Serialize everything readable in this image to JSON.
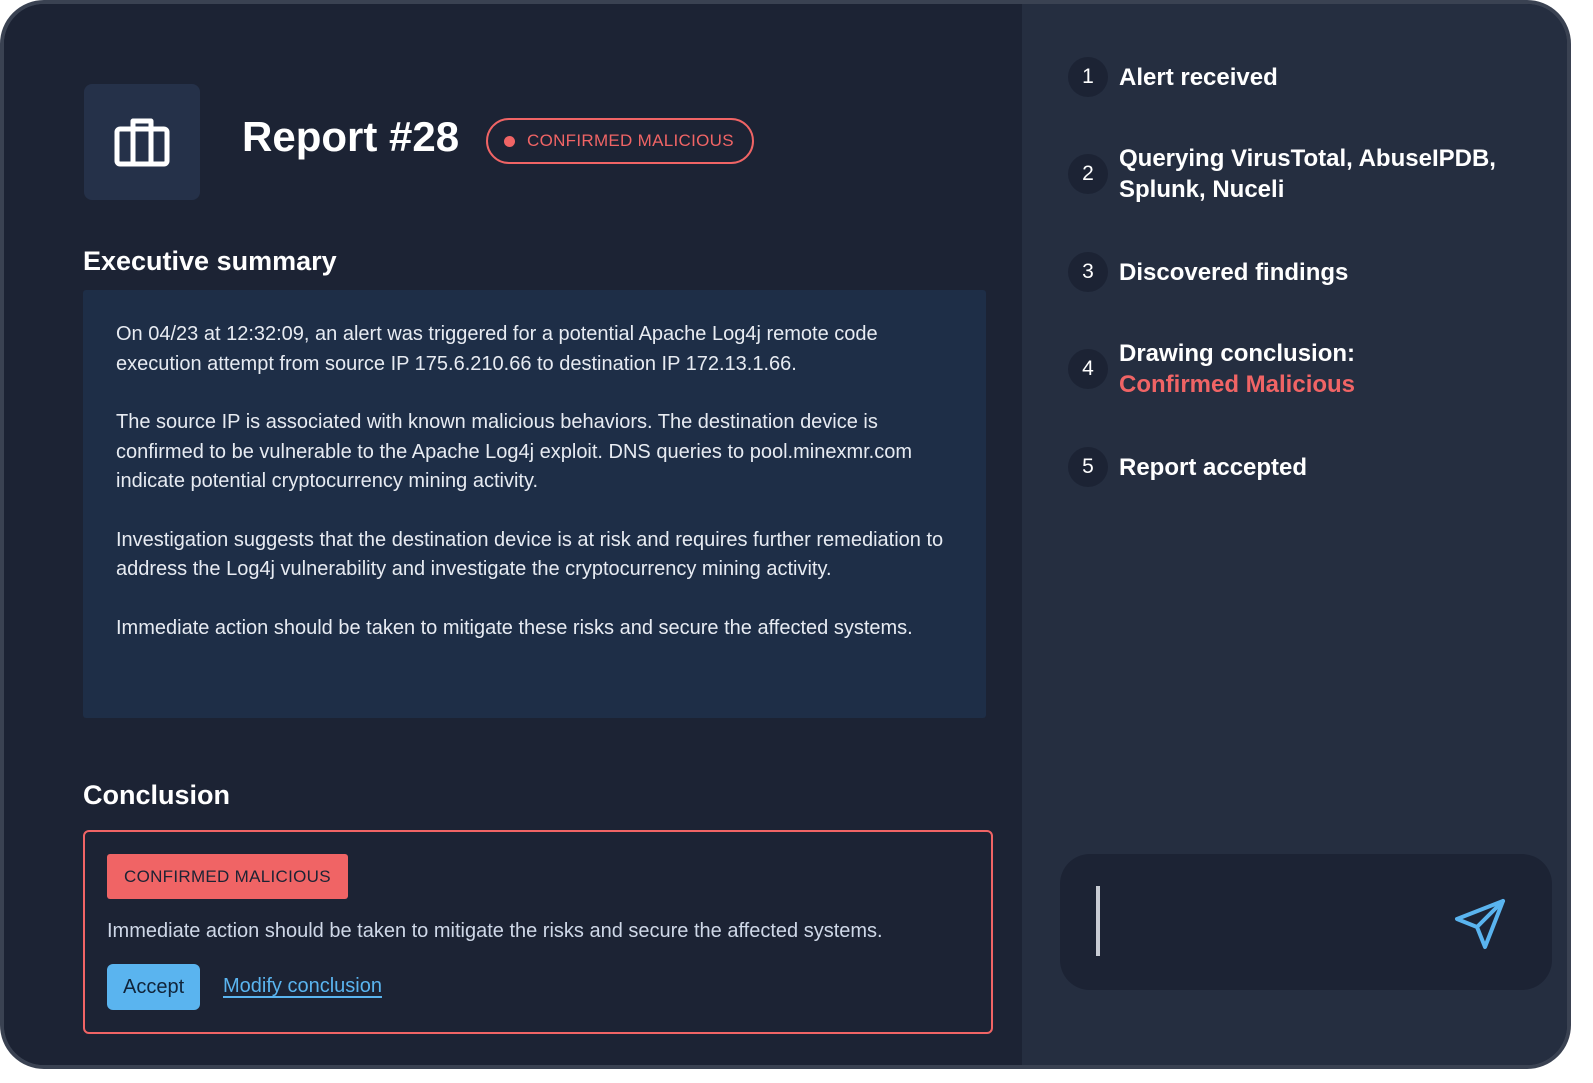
{
  "report": {
    "title": "Report #28",
    "status_badge": "CONFIRMED MALICIOUS",
    "logo_icon": "briefcase-icon"
  },
  "summary": {
    "heading": "Executive summary",
    "paragraphs": [
      "On 04/23 at 12:32:09, an alert was triggered for a potential Apache Log4j remote code execution attempt from source IP 175.6.210.66 to destination IP 172.13.1.66.",
      "The source IP is associated with known malicious behaviors. The destination device is confirmed to be vulnerable to the Apache Log4j exploit. DNS queries to pool.minexmr.com indicate potential cryptocurrency mining activity.",
      "Investigation suggests that the destination device is at risk and requires further remediation to address the Log4j vulnerability and investigate the cryptocurrency mining activity.",
      "Immediate action should be taken to mitigate these risks and secure the affected systems."
    ]
  },
  "conclusion": {
    "heading": "Conclusion",
    "badge": "CONFIRMED MALICIOUS",
    "text": "Immediate action should be taken to mitigate the risks and secure the affected systems.",
    "accept_label": "Accept",
    "modify_label": "Modify conclusion"
  },
  "steps": [
    {
      "number": "1",
      "label": "Alert received"
    },
    {
      "number": "2",
      "label": "Querying VirusTotal, AbuseIPDB, Splunk, Nuceli"
    },
    {
      "number": "3",
      "label": "Discovered findings"
    },
    {
      "number": "4",
      "label": "Drawing conclusion:",
      "highlight": "Confirmed Malicious"
    },
    {
      "number": "5",
      "label": "Report accepted"
    }
  ],
  "chat": {
    "input_value": "",
    "send_icon": "send-icon"
  },
  "colors": {
    "danger": "#f06465",
    "accent": "#5ab4ef",
    "panel_left": "#1c2334",
    "panel_right": "#252e40",
    "summary_bg": "#1e2e47"
  }
}
